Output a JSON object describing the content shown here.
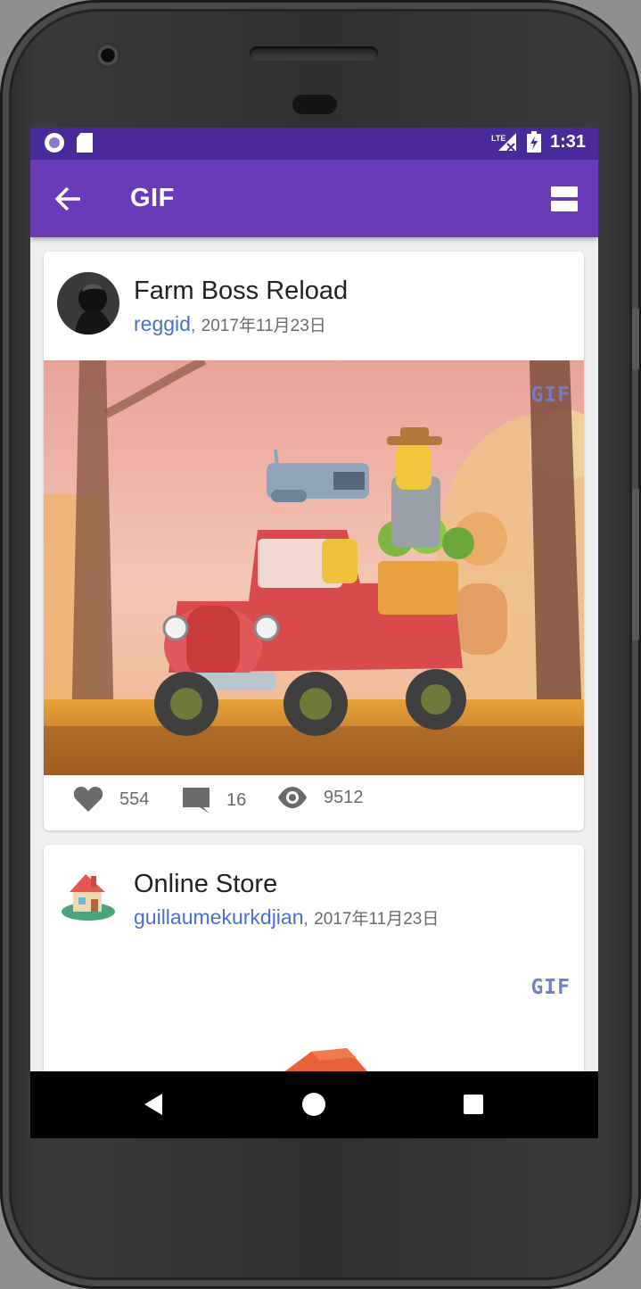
{
  "statusbar": {
    "network": "LTE",
    "time": "1:31"
  },
  "appbar": {
    "title": "GIF",
    "back_icon": "arrow-back-icon",
    "layout_icon": "view-agenda-icon"
  },
  "posts": [
    {
      "title": "Farm Boss Reload",
      "author": "reggid",
      "date": "2017年11月23日",
      "badge": "GIF",
      "likes": "554",
      "comments": "16",
      "views": "9512"
    },
    {
      "title": "Online Store",
      "author": "guillaumekurkdjian",
      "date": "2017年11月23日",
      "badge": "GIF"
    }
  ],
  "colors": {
    "statusbar": "#4a2a9a",
    "appbar": "#6a3bb8",
    "author_link": "#4a6fd4",
    "gif_badge": "#6f7fd0"
  }
}
